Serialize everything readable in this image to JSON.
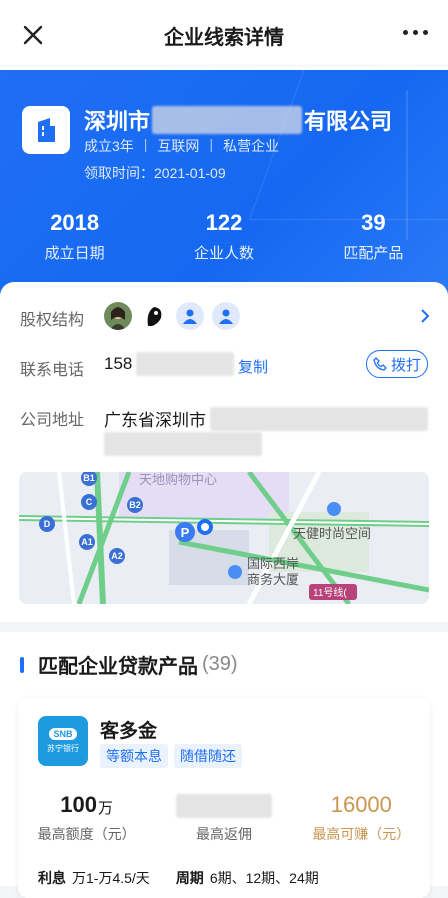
{
  "topbar": {
    "title": "企业线索详情"
  },
  "company": {
    "name_prefix": "深圳市",
    "name_suffix": "有限公司",
    "age": "成立3年",
    "industry": "互联网",
    "type": "私营企业",
    "received_label": "领取时间：",
    "received_date": "2021-01-09"
  },
  "stats": [
    {
      "value": "2018",
      "label": "成立日期"
    },
    {
      "value": "122",
      "label": "企业人数"
    },
    {
      "value": "39",
      "label": "匹配产品"
    }
  ],
  "info": {
    "equity_label": "股权结构",
    "phone_label": "联系电话",
    "phone_prefix": "158",
    "copy_label": "复制",
    "call_label": "拨打",
    "address_label": "公司地址",
    "address_prefix": "广东省深圳市"
  },
  "map": {
    "labels": [
      "天地购物中心",
      "天健时尚空间",
      "国际西岸",
      "商务大厦",
      "11号线("
    ],
    "markers": [
      "B1",
      "B2",
      "C",
      "D",
      "A1",
      "A2"
    ]
  },
  "products": {
    "title": "匹配企业贷款产品",
    "count": "(39)",
    "items": [
      {
        "bank_logo_text": "SNB",
        "bank_name": "苏宁银行",
        "name": "客多金",
        "tags": [
          "等额本息",
          "随借随还"
        ],
        "max_amount": "100",
        "max_amount_unit": "万",
        "max_amount_label": "最高额度（元）",
        "max_rebate_label": "最高返佣",
        "max_earn": "16000",
        "max_earn_label": "最高可赚（元）",
        "interest_label": "利息",
        "interest_value": "万1-万4.5/天",
        "period_label": "周期",
        "period_value": "6期、12期、24期"
      }
    ]
  },
  "colors": {
    "accent": "#1f6ff5",
    "gold": "#c9964f"
  }
}
